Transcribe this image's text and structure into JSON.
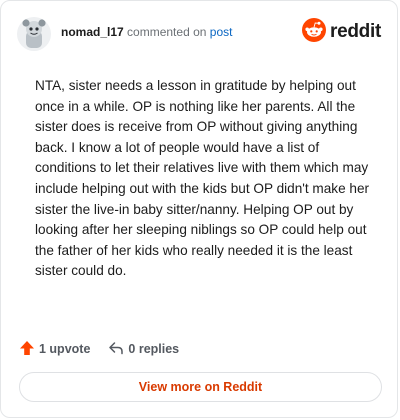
{
  "header": {
    "username": "nomad_l17",
    "action_text": "commented on",
    "post_link": "post",
    "brand_name": "reddit",
    "brand_color": "#ff4500",
    "avatar_icon": "snoo-avatar-icon"
  },
  "comment": {
    "body": "NTA, sister needs a lesson in gratitude by helping out once in a while. OP is nothing like her parents. All the sister does is receive from OP without giving anything back. I know a lot of people would have a list of conditions to let their relatives live with them which may include helping out with the kids but OP didn't make her sister the live-in baby sitter/nanny. Helping OP out by looking after her sleeping niblings so OP could help out the father of her kids who really needed it is the least sister could do."
  },
  "actions": {
    "upvote_label": "1 upvote",
    "upvote_icon": "upvote-arrow-icon",
    "upvote_color": "#ff4500",
    "replies_label": "0 replies",
    "replies_icon": "reply-icon"
  },
  "footer": {
    "view_more_label": "View more on Reddit",
    "view_more_color": "#d93a00"
  }
}
